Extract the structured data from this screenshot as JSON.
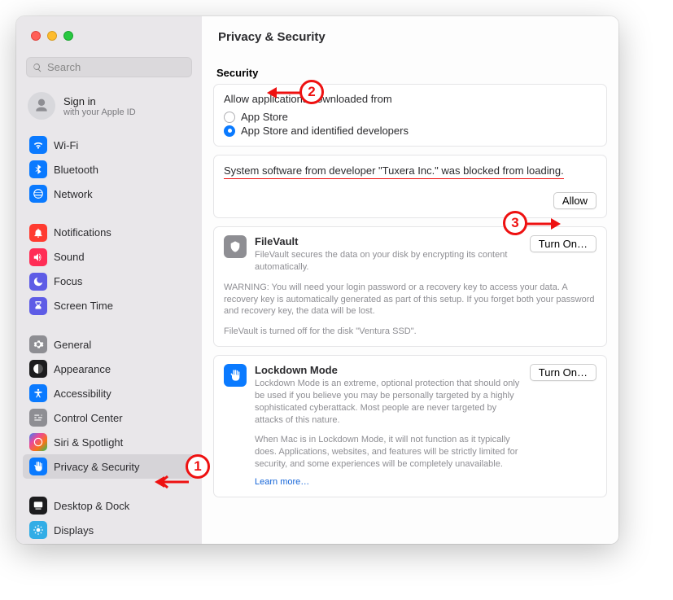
{
  "window_title": "Privacy & Security",
  "search": {
    "placeholder": "Search"
  },
  "account": {
    "line1": "Sign in",
    "line2": "with your Apple ID"
  },
  "sidebar": {
    "items": [
      {
        "label": "Wi-Fi"
      },
      {
        "label": "Bluetooth"
      },
      {
        "label": "Network"
      },
      {
        "label": "Notifications"
      },
      {
        "label": "Sound"
      },
      {
        "label": "Focus"
      },
      {
        "label": "Screen Time"
      },
      {
        "label": "General"
      },
      {
        "label": "Appearance"
      },
      {
        "label": "Accessibility"
      },
      {
        "label": "Control Center"
      },
      {
        "label": "Siri & Spotlight"
      },
      {
        "label": "Privacy & Security"
      },
      {
        "label": "Desktop & Dock"
      },
      {
        "label": "Displays"
      }
    ]
  },
  "security": {
    "title": "Security",
    "allow_title": "Allow applications downloaded from",
    "option1": "App Store",
    "option2": "App Store and identified developers",
    "blocked_msg": "System software from developer \"Tuxera Inc.\" was blocked from loading.",
    "allow_btn": "Allow"
  },
  "filevault": {
    "title": "FileVault",
    "desc": "FileVault secures the data on your disk by encrypting its content automatically.",
    "btn": "Turn On…",
    "warn": "WARNING: You will need your login password or a recovery key to access your data. A recovery key is automatically generated as part of this setup. If you forget both your password and recovery key, the data will be lost.",
    "status": "FileVault is turned off for the disk \"Ventura SSD\"."
  },
  "lockdown": {
    "title": "Lockdown Mode",
    "desc": "Lockdown Mode is an extreme, optional protection that should only be used if you believe you may be personally targeted by a highly sophisticated cyberattack. Most people are never targeted by attacks of this nature.",
    "desc2": "When Mac is in Lockdown Mode, it will not function as it typically does. Applications, websites, and features will be strictly limited for security, and some experiences will be completely unavailable.",
    "link": "Learn more…",
    "btn": "Turn On…"
  },
  "annotations": {
    "n1": "1",
    "n2": "2",
    "n3": "3"
  }
}
